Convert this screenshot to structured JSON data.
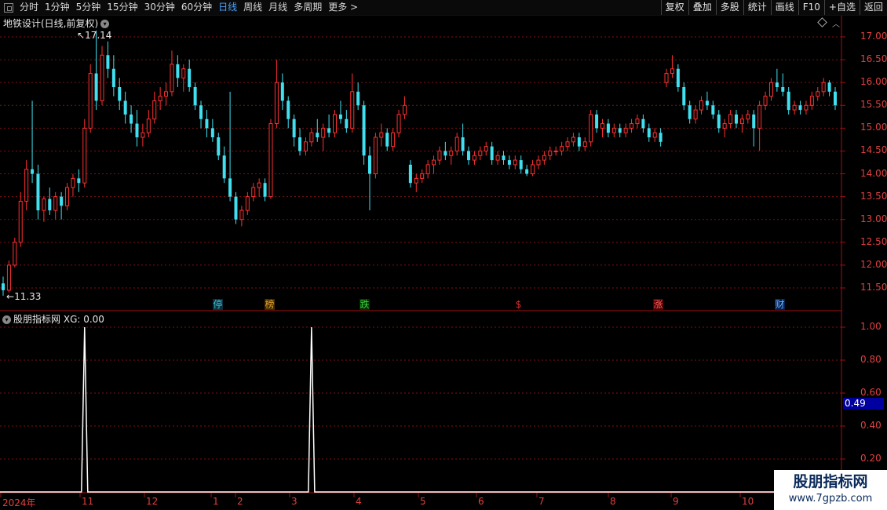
{
  "toolbar": {
    "periods": [
      "分时",
      "1分钟",
      "5分钟",
      "15分钟",
      "30分钟",
      "60分钟",
      "日线",
      "周线",
      "月线",
      "多周期",
      "更多"
    ],
    "active_index": 6,
    "buttons": [
      "复权",
      "叠加",
      "多股",
      "统计",
      "画线",
      "F10",
      "+自选",
      "返回"
    ]
  },
  "chart": {
    "title": "地铁设计(日线,前复权)",
    "high_mark": "17.14",
    "low_mark": "11.33",
    "y_ticks": [
      "17.00",
      "16.50",
      "16.00",
      "15.50",
      "15.00",
      "14.50",
      "14.00",
      "13.50",
      "13.00",
      "12.50",
      "12.00",
      "11.50"
    ],
    "event_tags": [
      {
        "text": "停",
        "color": "#40c0d0",
        "bg": "#0a3040"
      },
      {
        "text": "榜",
        "color": "#e0a030",
        "bg": "#402a00"
      },
      {
        "text": "跌",
        "color": "#40d040",
        "bg": "#003000"
      },
      {
        "text": "$",
        "color": "#e03030",
        "bg": "#000000"
      },
      {
        "text": "涨",
        "color": "#ff6060",
        "bg": "#500000"
      },
      {
        "text": "财",
        "color": "#70b0ff",
        "bg": "#002050"
      }
    ]
  },
  "indicator": {
    "title": "股朋指标网",
    "label": "XG: 0.00",
    "y_ticks": [
      "1.00",
      "0.80",
      "0.60",
      "0.40",
      "0.20"
    ],
    "current_value": "0.49"
  },
  "x_axis": {
    "labels": [
      "2024年",
      "11",
      "12",
      "1",
      "2",
      "3",
      "4",
      "5",
      "6",
      "7",
      "8",
      "9",
      "10"
    ]
  },
  "watermark": {
    "line1": "股朋指标网",
    "line2": "www.7gpzb.com"
  },
  "colors": {
    "up": "#ff3030",
    "down": "#40e0f0",
    "grid": "#801010",
    "axis_text": "#e04040",
    "active_tab": "#4aa3ff"
  },
  "chart_data": [
    {
      "type": "candlestick",
      "title": "地铁设计(日线,前复权)",
      "ylim": [
        11.2,
        17.3
      ],
      "y_ticks": [
        17.0,
        16.5,
        16.0,
        15.5,
        15.0,
        14.5,
        14.0,
        13.5,
        13.0,
        12.5,
        12.0,
        11.5
      ],
      "annotations": [
        {
          "label": "17.14",
          "type": "high"
        },
        {
          "label": "11.33",
          "type": "low"
        }
      ],
      "ohlc": [
        [
          11.6,
          11.75,
          11.33,
          11.45
        ],
        [
          11.45,
          12.1,
          11.4,
          12.0
        ],
        [
          12.0,
          12.6,
          11.95,
          12.5
        ],
        [
          12.5,
          13.6,
          12.4,
          13.4
        ],
        [
          13.4,
          14.3,
          13.2,
          14.1
        ],
        [
          14.1,
          15.6,
          13.8,
          14.0
        ],
        [
          14.0,
          14.2,
          13.0,
          13.2
        ],
        [
          13.2,
          13.5,
          12.95,
          13.45
        ],
        [
          13.45,
          13.7,
          13.1,
          13.2
        ],
        [
          13.2,
          13.6,
          13.0,
          13.5
        ],
        [
          13.5,
          13.6,
          13.0,
          13.3
        ],
        [
          13.3,
          13.8,
          13.2,
          13.7
        ],
        [
          13.7,
          14.0,
          13.5,
          13.9
        ],
        [
          13.9,
          14.1,
          13.6,
          13.8
        ],
        [
          13.8,
          15.2,
          13.7,
          15.0
        ],
        [
          15.0,
          16.4,
          14.9,
          16.2
        ],
        [
          16.2,
          17.14,
          15.4,
          15.6
        ],
        [
          15.6,
          16.8,
          15.5,
          16.6
        ],
        [
          16.6,
          16.9,
          16.1,
          16.3
        ],
        [
          16.3,
          16.6,
          15.7,
          15.9
        ],
        [
          15.9,
          16.1,
          15.4,
          15.6
        ],
        [
          15.6,
          15.8,
          15.1,
          15.3
        ],
        [
          15.3,
          15.5,
          14.9,
          15.1
        ],
        [
          15.1,
          15.4,
          14.6,
          14.8
        ],
        [
          14.8,
          15.1,
          14.6,
          14.9
        ],
        [
          14.9,
          15.4,
          14.8,
          15.2
        ],
        [
          15.2,
          15.8,
          15.1,
          15.6
        ],
        [
          15.6,
          15.9,
          15.4,
          15.7
        ],
        [
          15.7,
          16.0,
          15.5,
          15.8
        ],
        [
          15.8,
          16.7,
          15.7,
          16.4
        ],
        [
          16.4,
          16.6,
          15.9,
          16.1
        ],
        [
          16.1,
          16.4,
          15.8,
          16.3
        ],
        [
          16.3,
          16.5,
          15.8,
          15.9
        ],
        [
          15.9,
          16.0,
          15.4,
          15.5
        ],
        [
          15.5,
          15.6,
          15.0,
          15.2
        ],
        [
          15.2,
          15.4,
          14.8,
          15.0
        ],
        [
          15.0,
          15.2,
          14.7,
          14.8
        ],
        [
          14.8,
          14.9,
          14.3,
          14.4
        ],
        [
          14.4,
          14.6,
          13.8,
          13.9
        ],
        [
          13.9,
          15.8,
          13.4,
          13.5
        ],
        [
          13.5,
          13.6,
          12.9,
          13.0
        ],
        [
          13.0,
          13.3,
          12.85,
          13.2
        ],
        [
          13.2,
          13.6,
          13.1,
          13.5
        ],
        [
          13.5,
          13.8,
          13.4,
          13.7
        ],
        [
          13.7,
          13.9,
          13.5,
          13.8
        ],
        [
          13.8,
          13.9,
          13.4,
          13.5
        ],
        [
          13.5,
          15.2,
          13.45,
          15.1
        ],
        [
          15.1,
          16.5,
          15.0,
          16.0
        ],
        [
          16.0,
          16.2,
          15.4,
          15.6
        ],
        [
          15.6,
          15.7,
          15.0,
          15.2
        ],
        [
          15.2,
          15.3,
          14.6,
          14.8
        ],
        [
          14.8,
          15.0,
          14.4,
          14.5
        ],
        [
          14.5,
          14.8,
          14.4,
          14.7
        ],
        [
          14.7,
          15.0,
          14.6,
          14.9
        ],
        [
          14.9,
          15.2,
          14.7,
          14.8
        ],
        [
          14.8,
          15.1,
          14.5,
          15.0
        ],
        [
          15.0,
          15.3,
          14.8,
          14.9
        ],
        [
          14.9,
          15.4,
          14.8,
          15.3
        ],
        [
          15.3,
          15.6,
          15.1,
          15.2
        ],
        [
          15.2,
          15.4,
          14.9,
          15.0
        ],
        [
          15.0,
          16.2,
          14.9,
          15.8
        ],
        [
          15.8,
          16.0,
          15.4,
          15.5
        ],
        [
          15.5,
          15.6,
          14.2,
          14.4
        ],
        [
          14.4,
          14.6,
          13.2,
          14.0
        ],
        [
          14.0,
          14.9,
          13.9,
          14.8
        ],
        [
          14.8,
          15.1,
          14.6,
          14.9
        ],
        [
          14.9,
          15.0,
          14.5,
          14.6
        ],
        [
          14.6,
          15.0,
          14.5,
          14.9
        ],
        [
          14.9,
          15.4,
          14.8,
          15.3
        ],
        [
          15.3,
          15.7,
          15.2,
          15.5
        ],
        [
          14.2,
          14.3,
          13.7,
          13.8
        ],
        [
          13.8,
          14.0,
          13.6,
          13.9
        ],
        [
          13.9,
          14.1,
          13.8,
          14.0
        ],
        [
          14.0,
          14.3,
          13.9,
          14.2
        ],
        [
          14.2,
          14.4,
          14.0,
          14.3
        ],
        [
          14.3,
          14.6,
          14.2,
          14.5
        ],
        [
          14.5,
          14.7,
          14.3,
          14.4
        ],
        [
          14.4,
          14.6,
          14.2,
          14.5
        ],
        [
          14.5,
          14.9,
          14.4,
          14.8
        ],
        [
          14.8,
          15.1,
          14.4,
          14.5
        ],
        [
          14.5,
          14.6,
          14.2,
          14.3
        ],
        [
          14.3,
          14.5,
          14.2,
          14.4
        ],
        [
          14.4,
          14.6,
          14.3,
          14.5
        ],
        [
          14.5,
          14.7,
          14.4,
          14.6
        ],
        [
          14.6,
          14.7,
          14.2,
          14.3
        ],
        [
          14.3,
          14.5,
          14.2,
          14.4
        ],
        [
          14.4,
          14.5,
          14.2,
          14.3
        ],
        [
          14.3,
          14.4,
          14.1,
          14.2
        ],
        [
          14.2,
          14.4,
          14.1,
          14.3
        ],
        [
          14.3,
          14.4,
          14.0,
          14.1
        ],
        [
          14.1,
          14.2,
          13.95,
          14.0
        ],
        [
          14.0,
          14.3,
          13.95,
          14.2
        ],
        [
          14.2,
          14.4,
          14.1,
          14.3
        ],
        [
          14.3,
          14.5,
          14.2,
          14.4
        ],
        [
          14.4,
          14.6,
          14.3,
          14.5
        ],
        [
          14.5,
          14.6,
          14.4,
          14.5
        ],
        [
          14.5,
          14.7,
          14.4,
          14.6
        ],
        [
          14.6,
          14.8,
          14.5,
          14.7
        ],
        [
          14.7,
          14.9,
          14.6,
          14.8
        ],
        [
          14.8,
          14.9,
          14.5,
          14.6
        ],
        [
          14.6,
          14.8,
          14.5,
          14.7
        ],
        [
          14.7,
          15.4,
          14.6,
          15.3
        ],
        [
          15.3,
          15.4,
          14.9,
          15.0
        ],
        [
          15.0,
          15.2,
          14.8,
          15.1
        ],
        [
          15.1,
          15.2,
          14.8,
          14.9
        ],
        [
          14.9,
          15.1,
          14.8,
          15.0
        ],
        [
          15.0,
          15.1,
          14.8,
          14.9
        ],
        [
          14.9,
          15.1,
          14.8,
          15.0
        ],
        [
          15.0,
          15.2,
          14.9,
          15.1
        ],
        [
          15.1,
          15.3,
          15.0,
          15.2
        ],
        [
          15.2,
          15.3,
          14.9,
          15.0
        ],
        [
          15.0,
          15.1,
          14.7,
          14.8
        ],
        [
          14.8,
          15.0,
          14.7,
          14.9
        ],
        [
          14.9,
          15.0,
          14.6,
          14.7
        ],
        [
          16.0,
          16.3,
          15.9,
          16.2
        ],
        [
          16.2,
          16.6,
          16.1,
          16.3
        ],
        [
          16.3,
          16.4,
          15.8,
          15.9
        ],
        [
          15.9,
          16.0,
          15.4,
          15.5
        ],
        [
          15.5,
          15.6,
          15.1,
          15.2
        ],
        [
          15.2,
          15.5,
          15.1,
          15.4
        ],
        [
          15.4,
          15.7,
          15.3,
          15.6
        ],
        [
          15.6,
          15.8,
          15.4,
          15.5
        ],
        [
          15.5,
          15.6,
          15.2,
          15.3
        ],
        [
          15.3,
          15.4,
          14.9,
          15.0
        ],
        [
          15.0,
          15.2,
          14.8,
          15.1
        ],
        [
          15.1,
          15.4,
          15.0,
          15.3
        ],
        [
          15.3,
          15.4,
          15.0,
          15.1
        ],
        [
          15.1,
          15.3,
          14.9,
          15.2
        ],
        [
          15.2,
          15.4,
          15.1,
          15.3
        ],
        [
          15.3,
          15.4,
          14.6,
          15.0
        ],
        [
          15.0,
          15.6,
          14.5,
          15.5
        ],
        [
          15.5,
          15.8,
          15.4,
          15.7
        ],
        [
          15.7,
          16.1,
          15.6,
          16.0
        ],
        [
          16.0,
          16.3,
          15.8,
          15.9
        ],
        [
          15.9,
          16.2,
          15.7,
          15.8
        ],
        [
          15.8,
          15.9,
          15.3,
          15.4
        ],
        [
          15.4,
          15.6,
          15.3,
          15.5
        ],
        [
          15.5,
          15.6,
          15.3,
          15.4
        ],
        [
          15.4,
          15.6,
          15.3,
          15.5
        ],
        [
          15.5,
          15.8,
          15.4,
          15.7
        ],
        [
          15.7,
          15.9,
          15.6,
          15.8
        ],
        [
          15.8,
          16.1,
          15.7,
          16.0
        ],
        [
          16.0,
          16.05,
          15.7,
          15.8
        ],
        [
          15.8,
          15.9,
          15.4,
          15.5
        ]
      ]
    },
    {
      "type": "line",
      "title": "股朋指标网",
      "series": [
        {
          "name": "XG",
          "signal_at": [
            14,
            53
          ]
        }
      ],
      "ylim": [
        0,
        1.05
      ],
      "y_ticks": [
        1.0,
        0.8,
        0.6,
        0.4,
        0.2
      ],
      "current": 0.49
    }
  ]
}
